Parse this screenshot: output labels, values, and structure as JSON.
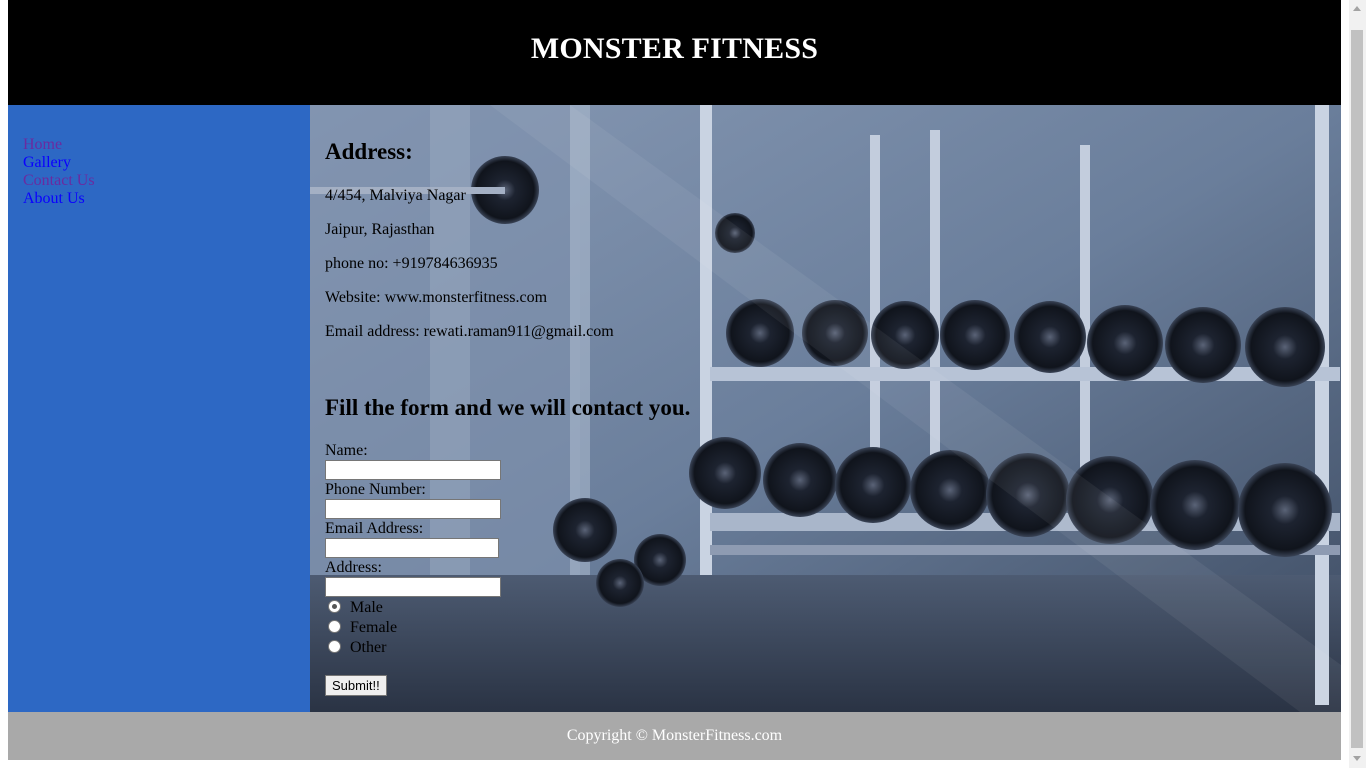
{
  "header": {
    "title": "MONSTER FITNESS"
  },
  "nav": {
    "items": [
      {
        "label": "Home",
        "visited": true
      },
      {
        "label": "Gallery",
        "visited": false
      },
      {
        "label": "Contact Us",
        "visited": true
      },
      {
        "label": "About Us",
        "visited": false
      }
    ]
  },
  "address": {
    "heading": "Address:",
    "line1": "4/454, Malviya Nagar",
    "line2": "Jaipur, Rajasthan",
    "phone": "phone no: +919784636935",
    "website": "Website: www.monsterfitness.com",
    "email": "Email address: rewati.raman911@gmail.com"
  },
  "form": {
    "heading": "Fill the form and we will contact you.",
    "name_label": "Name:",
    "name_value": "",
    "phone_label": "Phone Number:",
    "phone_value": "",
    "email_label": "Email Address:",
    "email_value": "",
    "address_label": "Address:",
    "address_value": "",
    "gender_options": [
      {
        "label": "Male",
        "checked": true
      },
      {
        "label": "Female",
        "checked": false
      },
      {
        "label": "Other",
        "checked": false
      }
    ],
    "submit_label": "Submit!!"
  },
  "footer": {
    "text": "Copyright © MonsterFitness.com"
  },
  "colors": {
    "header_bg": "#000000",
    "sidebar_bg": "#2d68c4",
    "footer_bg": "#a9a9a9",
    "link": "#0a00ff",
    "link_visited": "#6a2ba0"
  }
}
